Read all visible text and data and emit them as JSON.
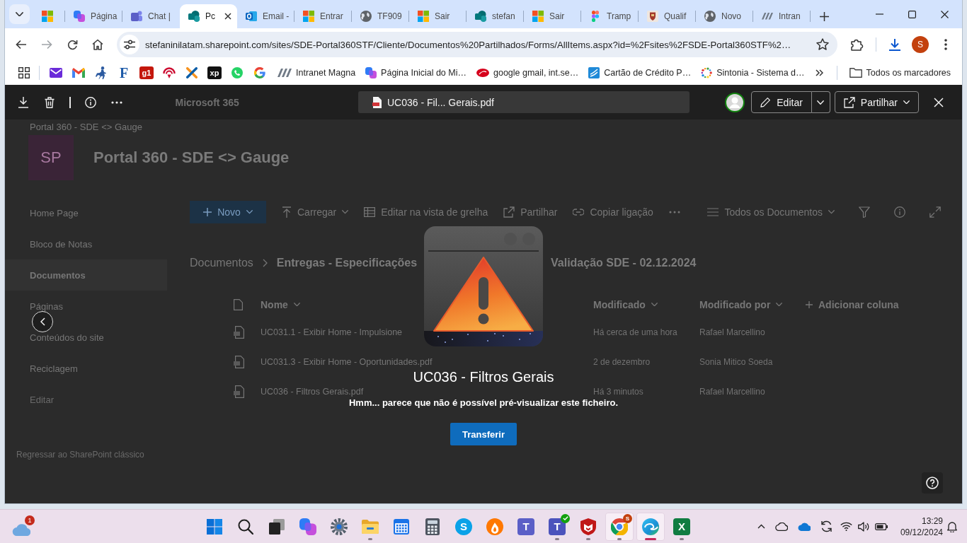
{
  "browser": {
    "tabs": [
      {
        "selected": false
      },
      {
        "title": "Página",
        "selected": false
      },
      {
        "title": "Chat |",
        "selected": false
      },
      {
        "title": "Pc",
        "selected": true
      },
      {
        "title": "Email -",
        "selected": false
      },
      {
        "title": "Entrar",
        "selected": false
      },
      {
        "title": "TF909",
        "selected": false
      },
      {
        "title": "Sair",
        "selected": false
      },
      {
        "title": "stefan",
        "selected": false
      },
      {
        "title": "Sair",
        "selected": false
      },
      {
        "title": "Tramp",
        "selected": false
      },
      {
        "title": "Qualif",
        "selected": false
      },
      {
        "title": "Novo",
        "selected": false
      },
      {
        "title": "Intran",
        "selected": false
      }
    ],
    "address": "stefaninilatam.sharepoint.com/sites/SDE-Portal360STF/Cliente/Documentos%20Partilhados/Forms/AllItems.aspx?id=%2Fsites%2FSDE-Portal360STF%2…",
    "profile_initial": "S",
    "bookmarks": [
      {
        "kind": "icon"
      },
      {
        "kind": "icon"
      },
      {
        "kind": "icon"
      },
      {
        "kind": "letter",
        "logo": "F"
      },
      {
        "kind": "tile",
        "logo": "g1"
      },
      {
        "kind": "icon"
      },
      {
        "kind": "icon"
      },
      {
        "kind": "tile",
        "logo": "xp"
      },
      {
        "kind": "icon"
      },
      {
        "kind": "icon"
      },
      {
        "kind": "link",
        "label": "Intranet Magna"
      },
      {
        "kind": "link",
        "label": "Página Inicial do Mi…"
      },
      {
        "kind": "link",
        "label": "google gmail, int.se…"
      },
      {
        "kind": "link",
        "label": "Cartão de Crédito P…"
      },
      {
        "kind": "link",
        "label": "Sintonia - Sistema d…"
      }
    ],
    "all_bookmarks": "Todos os marcadores"
  },
  "viewer": {
    "suite_title": "Microsoft 365",
    "file_name": "UC036 - Fil... Gerais.pdf",
    "edit": "Editar",
    "share": "Partilhar"
  },
  "site": {
    "breadcrumb": "Portal 360 - SDE <> Gauge",
    "logo_text": "SP",
    "title": "Portal 360 - SDE <> Gauge",
    "nav": [
      {
        "label": "Home Page",
        "kind": "link",
        "selected": false
      },
      {
        "label": "Bloco de Notas",
        "kind": "link",
        "selected": false
      },
      {
        "label": "Documentos",
        "kind": "link",
        "selected": true
      },
      {
        "label": "Páginas",
        "kind": "link",
        "selected": false
      },
      {
        "label": "Conteúdos do site",
        "kind": "link",
        "selected": false
      },
      {
        "label": "Reciclagem",
        "kind": "link",
        "selected": false
      },
      {
        "label": "Editar",
        "kind": "action",
        "selected": false
      }
    ],
    "classic_link": "Regressar ao SharePoint clássico",
    "commands": [
      {
        "kind": "primary",
        "label": "Novo"
      },
      {
        "kind": "command",
        "label": "Carregar",
        "menu": true
      },
      {
        "kind": "command",
        "label": "Editar na vista de grelha",
        "menu": false
      },
      {
        "kind": "command",
        "label": "Partilhar",
        "menu": false
      },
      {
        "kind": "command",
        "label": "Copiar ligação",
        "menu": false
      },
      {
        "kind": "more"
      }
    ],
    "view": "Todos os Documentos",
    "path": {
      "root": "Documentos",
      "current": [
        "Entregas - Especificações",
        "Validação SDE - 02.12.2024"
      ]
    },
    "columns": [
      {
        "label": "Nome",
        "kind": "sortable"
      },
      {
        "label": "Modificado",
        "kind": "sortable"
      },
      {
        "label": "Modificado por",
        "kind": "sortable"
      },
      {
        "label": "Adicionar coluna",
        "kind": "add"
      }
    ],
    "rows": [
      {
        "name": "UC031.1 - Exibir Home - Impulsione",
        "modified": "Há cerca de uma hora",
        "modified_by": "Rafael Marcellino"
      },
      {
        "name": "UC031.3 - Exibir Home - Oportunidades.pdf",
        "modified": "2 de dezembro",
        "modified_by": "Sonia Mitico Soeda"
      },
      {
        "name": "UC036 - Filtros Gerais.pdf",
        "modified": "Há 3 minutos",
        "modified_by": "Rafael Marcellino"
      }
    ]
  },
  "dialog": {
    "title": "UC036 - Filtros Gerais",
    "message": "Hmm... parece que não é possível pré-visualizar este ficheiro.",
    "action": "Transferir"
  },
  "taskbar": {
    "weather_badge": "1",
    "apps": [
      {
        "running": false,
        "focused": false,
        "highlighted": false
      },
      {
        "running": false,
        "focused": false,
        "highlighted": false
      },
      {
        "running": false,
        "focused": false,
        "highlighted": false
      },
      {
        "running": false,
        "focused": false,
        "highlighted": false
      },
      {
        "running": false,
        "focused": false,
        "highlighted": false
      },
      {
        "running": true,
        "focused": false,
        "highlighted": false
      },
      {
        "running": false,
        "focused": false,
        "highlighted": false
      },
      {
        "running": false,
        "focused": false,
        "highlighted": false
      },
      {
        "glyph": "S",
        "running": false,
        "focused": false,
        "highlighted": false
      },
      {
        "running": false,
        "focused": false,
        "highlighted": false
      },
      {
        "glyph": "T",
        "running": false,
        "focused": false,
        "highlighted": false
      },
      {
        "glyph": "T",
        "badge": {
          "kind": "check"
        },
        "running": true,
        "focused": false,
        "highlighted": false
      },
      {
        "running": true,
        "focused": false,
        "highlighted": false
      },
      {
        "badge": {
          "kind": "text",
          "text": "S"
        },
        "running": true,
        "focused": false,
        "highlighted": true
      },
      {
        "running": true,
        "focused": true,
        "highlighted": true
      },
      {
        "glyph": "X",
        "running": true,
        "focused": false,
        "highlighted": false
      }
    ],
    "time": "13:29",
    "date": "09/12/2024"
  }
}
